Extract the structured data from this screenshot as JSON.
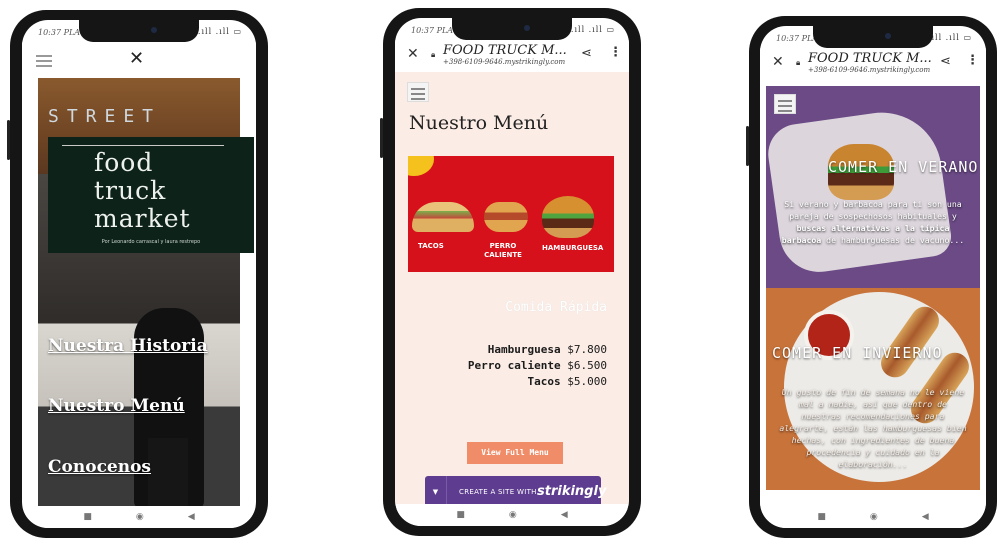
{
  "status": {
    "time": "10:37 PLA",
    "icons": "✱ .ıll .ıll ▭"
  },
  "phone1": {
    "street_sign": "STREET",
    "logo": {
      "line1": "food",
      "line2": "truck",
      "line3": "market",
      "subtitle": "Por Leonardo carrascal y laura restrepo"
    },
    "links": [
      "Nuestra Historia",
      "Nuestro Menú",
      "Conocenos"
    ]
  },
  "browser": {
    "title": "FOOD TRUCK M...",
    "url": "+398-6109-9646.mystrikingly.com"
  },
  "phone2": {
    "page_title": "Nuestro Menú",
    "banner_labels": [
      "TACOS",
      "PERRO CALIENTE",
      "HAMBURGUESA"
    ],
    "section_label": "Comida Rápida",
    "menu_items": [
      {
        "name": "Hamburguesa",
        "price": "$7.800"
      },
      {
        "name": "Perro caliente",
        "price": "$6.500"
      },
      {
        "name": "Tacos",
        "price": "$5.000"
      }
    ],
    "view_full_menu": "View Full Menu",
    "strikingly": {
      "prefix": "CREATE A SITE WITH",
      "brand": "strikingly"
    }
  },
  "phone3": {
    "verano": {
      "title": "COMER EN VERANO",
      "body_part1": "Si verano y barbacoa para ti son una pareja de sospechosos habituales y",
      "body_bold": "buscas alternativas a la típica barbacoa",
      "body_part2": "de hamburguesas de vacuno..."
    },
    "invierno": {
      "title": "COMER EN INVIERNO",
      "body": "Un gusto de fin de semana no le viene mal a nadie, así que dentro de nuestras recomendaciones para alegrarte, están las hamburguesas bien hechas, con ingredientes de buena procedencia y cuidado en la elaboración..."
    }
  },
  "colors": {
    "menu_banner": "#d7111b",
    "strikingly": "#5e3d90",
    "button": "#f08d68",
    "page_bg": "#fbece5"
  }
}
